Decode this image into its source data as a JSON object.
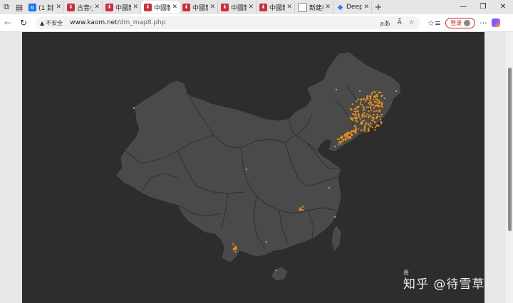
{
  "tabs": [
    {
      "favicon": "zhihu-icon",
      "fav_text": "知",
      "title": "(1 封私"
    },
    {
      "favicon": "ancient-icon",
      "fav_text": "",
      "title": "古音小"
    },
    {
      "favicon": "map-site-icon",
      "fav_text": "",
      "title": "中國製"
    },
    {
      "favicon": "map-site-icon",
      "fav_text": "",
      "title": "中國製",
      "active": true
    },
    {
      "favicon": "map-site-icon",
      "fav_text": "",
      "title": "中國製"
    },
    {
      "favicon": "map-site-icon",
      "fav_text": "",
      "title": "中國製"
    },
    {
      "favicon": "map-site-icon",
      "fav_text": "",
      "title": "中國製"
    },
    {
      "favicon": "note-icon",
      "fav_text": "",
      "title": "新建标"
    },
    {
      "favicon": "deepseek-icon",
      "fav_text": "",
      "title": "DeepS"
    }
  ],
  "address": {
    "security_label": "不安全",
    "host": "www.kaom.net",
    "path": "/dm_map8.php"
  },
  "toolbar": {
    "read_aloud": "aあ",
    "login_label": "登录"
  },
  "watermark": {
    "main": "知乎 @待雪草",
    "small": "贵"
  },
  "map": {
    "background": "#2d2d2d",
    "land_color": "#4a4a4a",
    "border_color": "#2e2e2e",
    "dot_color": "#e8901c"
  }
}
